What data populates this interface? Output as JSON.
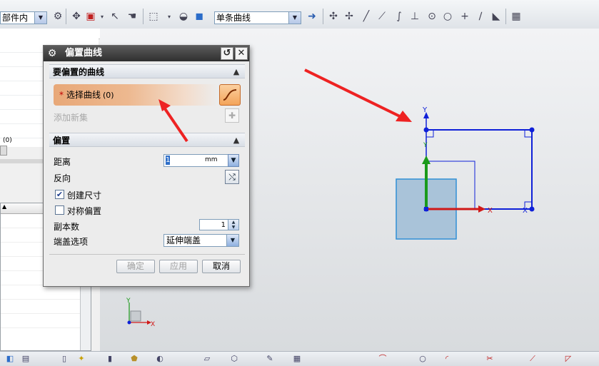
{
  "toolbar": {
    "filter_value": "部件内",
    "curve_rule_value": "单条曲线"
  },
  "dialog": {
    "title": "偏置曲线",
    "section_curve": "要偏置的曲线",
    "select_curve_label": "选择曲线",
    "select_curve_count": "(0)",
    "add_new_set": "添加新集",
    "section_offset": "偏置",
    "distance_label": "距离",
    "distance_value": "1",
    "distance_unit": "mm",
    "reverse_label": "反向",
    "create_dimension_label": "创建尺寸",
    "create_dimension_checked": true,
    "symmetric_label": "对称偏置",
    "symmetric_checked": false,
    "copies_label": "副本数",
    "copies_value": "1",
    "cap_label": "端盖选项",
    "cap_value": "延伸端盖",
    "ok_label": "确定",
    "apply_label": "应用",
    "cancel_label": "取消"
  },
  "left_panel": {
    "small_value": "(0)"
  },
  "viewport": {
    "sketch_y_label": "Y",
    "sketch_x_label": "X",
    "origin_y_label": "Y",
    "origin_x_label": "X",
    "triad_y_label": "Y",
    "triad_x_label": "X"
  },
  "colors": {
    "sketch_blue": "#0f20d8",
    "datum_red": "#d01818",
    "datum_green": "#1a9a1a",
    "arrow_red": "#ee2222",
    "selection_orange": "#e8a878"
  },
  "icons": [
    "gear-icon",
    "reset-icon",
    "close-icon",
    "curve-icon",
    "add-icon",
    "reverse-icon",
    "chevron-up-icon"
  ]
}
